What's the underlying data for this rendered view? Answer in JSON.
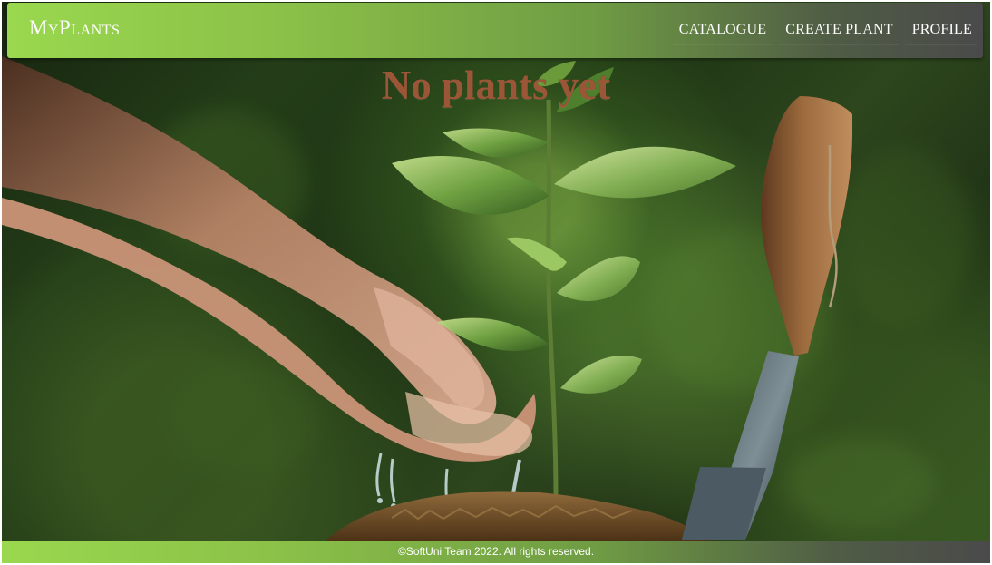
{
  "app": {
    "brand": "MyPlants"
  },
  "nav": {
    "items": [
      {
        "label": "CATALOGUE"
      },
      {
        "label": "CREATE PLANT"
      },
      {
        "label": "PROFILE"
      }
    ]
  },
  "main": {
    "empty_message": "No plants yet"
  },
  "footer": {
    "text": "©SoftUni Team 2022. All rights reserved."
  },
  "colors": {
    "header_start": "#9ad84f",
    "header_end": "#4a4a4a",
    "title_text": "#9b5637",
    "white": "#ffffff"
  },
  "icons": {
    "decorative": [
      "hands-illustration",
      "seedling-illustration",
      "garden-trowel-illustration"
    ]
  }
}
